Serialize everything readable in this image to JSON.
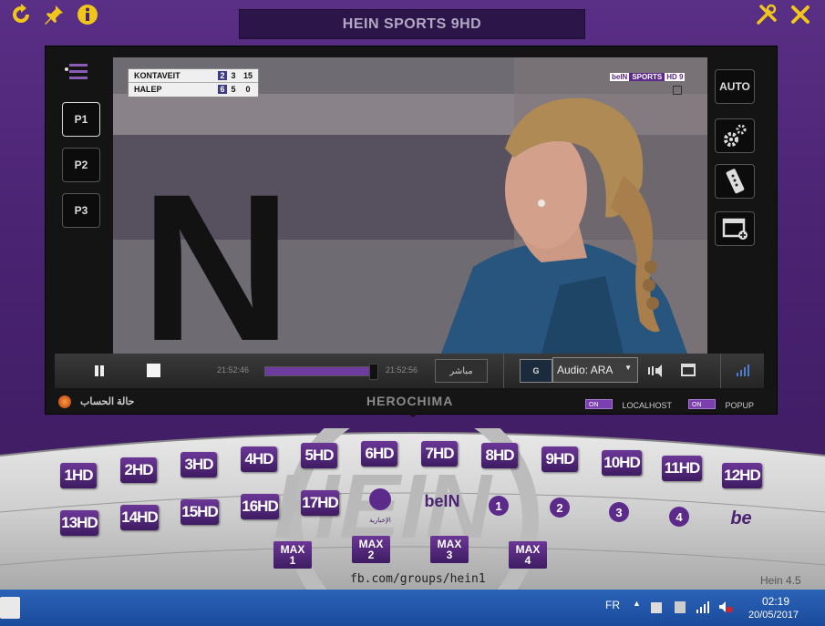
{
  "window": {
    "title": "HEIN SPORTS 9HD",
    "icons": [
      "refresh-icon",
      "pin-icon",
      "info-icon",
      "tools-icon",
      "close-icon"
    ]
  },
  "scoreboard": {
    "rows": [
      {
        "name": "KONTAVEIT",
        "s1": "2",
        "s2": "3",
        "pts": "15"
      },
      {
        "name": "HALEP",
        "s1": "6",
        "s2": "5",
        "pts": "0"
      }
    ]
  },
  "overlay": {
    "logo_text": "beIN",
    "sports_text": "SPORTS",
    "channel_badge": "HD 9",
    "bg_text": "N"
  },
  "left_panel": {
    "presets": [
      "P1",
      "P2",
      "P3"
    ]
  },
  "right_panel": {
    "auto_label": "AUTO",
    "icons": [
      "settings-icon",
      "remote-icon",
      "new-window-icon"
    ]
  },
  "controls": {
    "time_start": "21:52:46",
    "time_end": "21:52:56",
    "progress": 0.97,
    "live_label": "مباشر",
    "g_label": "G",
    "audio_select": "Audio: ARA"
  },
  "status_bar": {
    "account_label": "حالة الحساب",
    "brand": "HEROCHIMA",
    "toggles": [
      {
        "state": "ON",
        "label": "LOCALHOST"
      },
      {
        "state": "ON",
        "label": "POPUP"
      }
    ]
  },
  "channels": {
    "row1": [
      "1HD",
      "2HD",
      "3HD",
      "4HD",
      "5HD",
      "6HD",
      "7HD",
      "8HD",
      "9HD",
      "10HD",
      "11HD",
      "12HD"
    ],
    "row2_hd": [
      "13HD",
      "14HD",
      "15HD",
      "16HD",
      "17HD"
    ],
    "row2_logos": [
      {
        "name": "bein-news-logo",
        "text": "الإخبارية"
      },
      {
        "name": "bein-sports-logo",
        "text": "beIN"
      },
      {
        "name": "bein-1hd-logo",
        "text": "1"
      },
      {
        "name": "bein-2hd-logo",
        "text": "2"
      },
      {
        "name": "bein-3hd-logo",
        "text": "3"
      },
      {
        "name": "bein-4hd-logo",
        "text": "4"
      },
      {
        "name": "bein-junior-logo",
        "text": "be"
      }
    ],
    "max": [
      {
        "label": "MAX",
        "num": "1"
      },
      {
        "label": "MAX",
        "num": "2"
      },
      {
        "label": "MAX",
        "num": "3"
      },
      {
        "label": "MAX",
        "num": "4"
      }
    ],
    "footer_link": "fb.com/groups/hein1",
    "version": "Hein 4.5",
    "bg_watermark": "HEIN"
  },
  "taskbar": {
    "lang": "FR",
    "time": "02:19",
    "date": "20/05/2017"
  }
}
